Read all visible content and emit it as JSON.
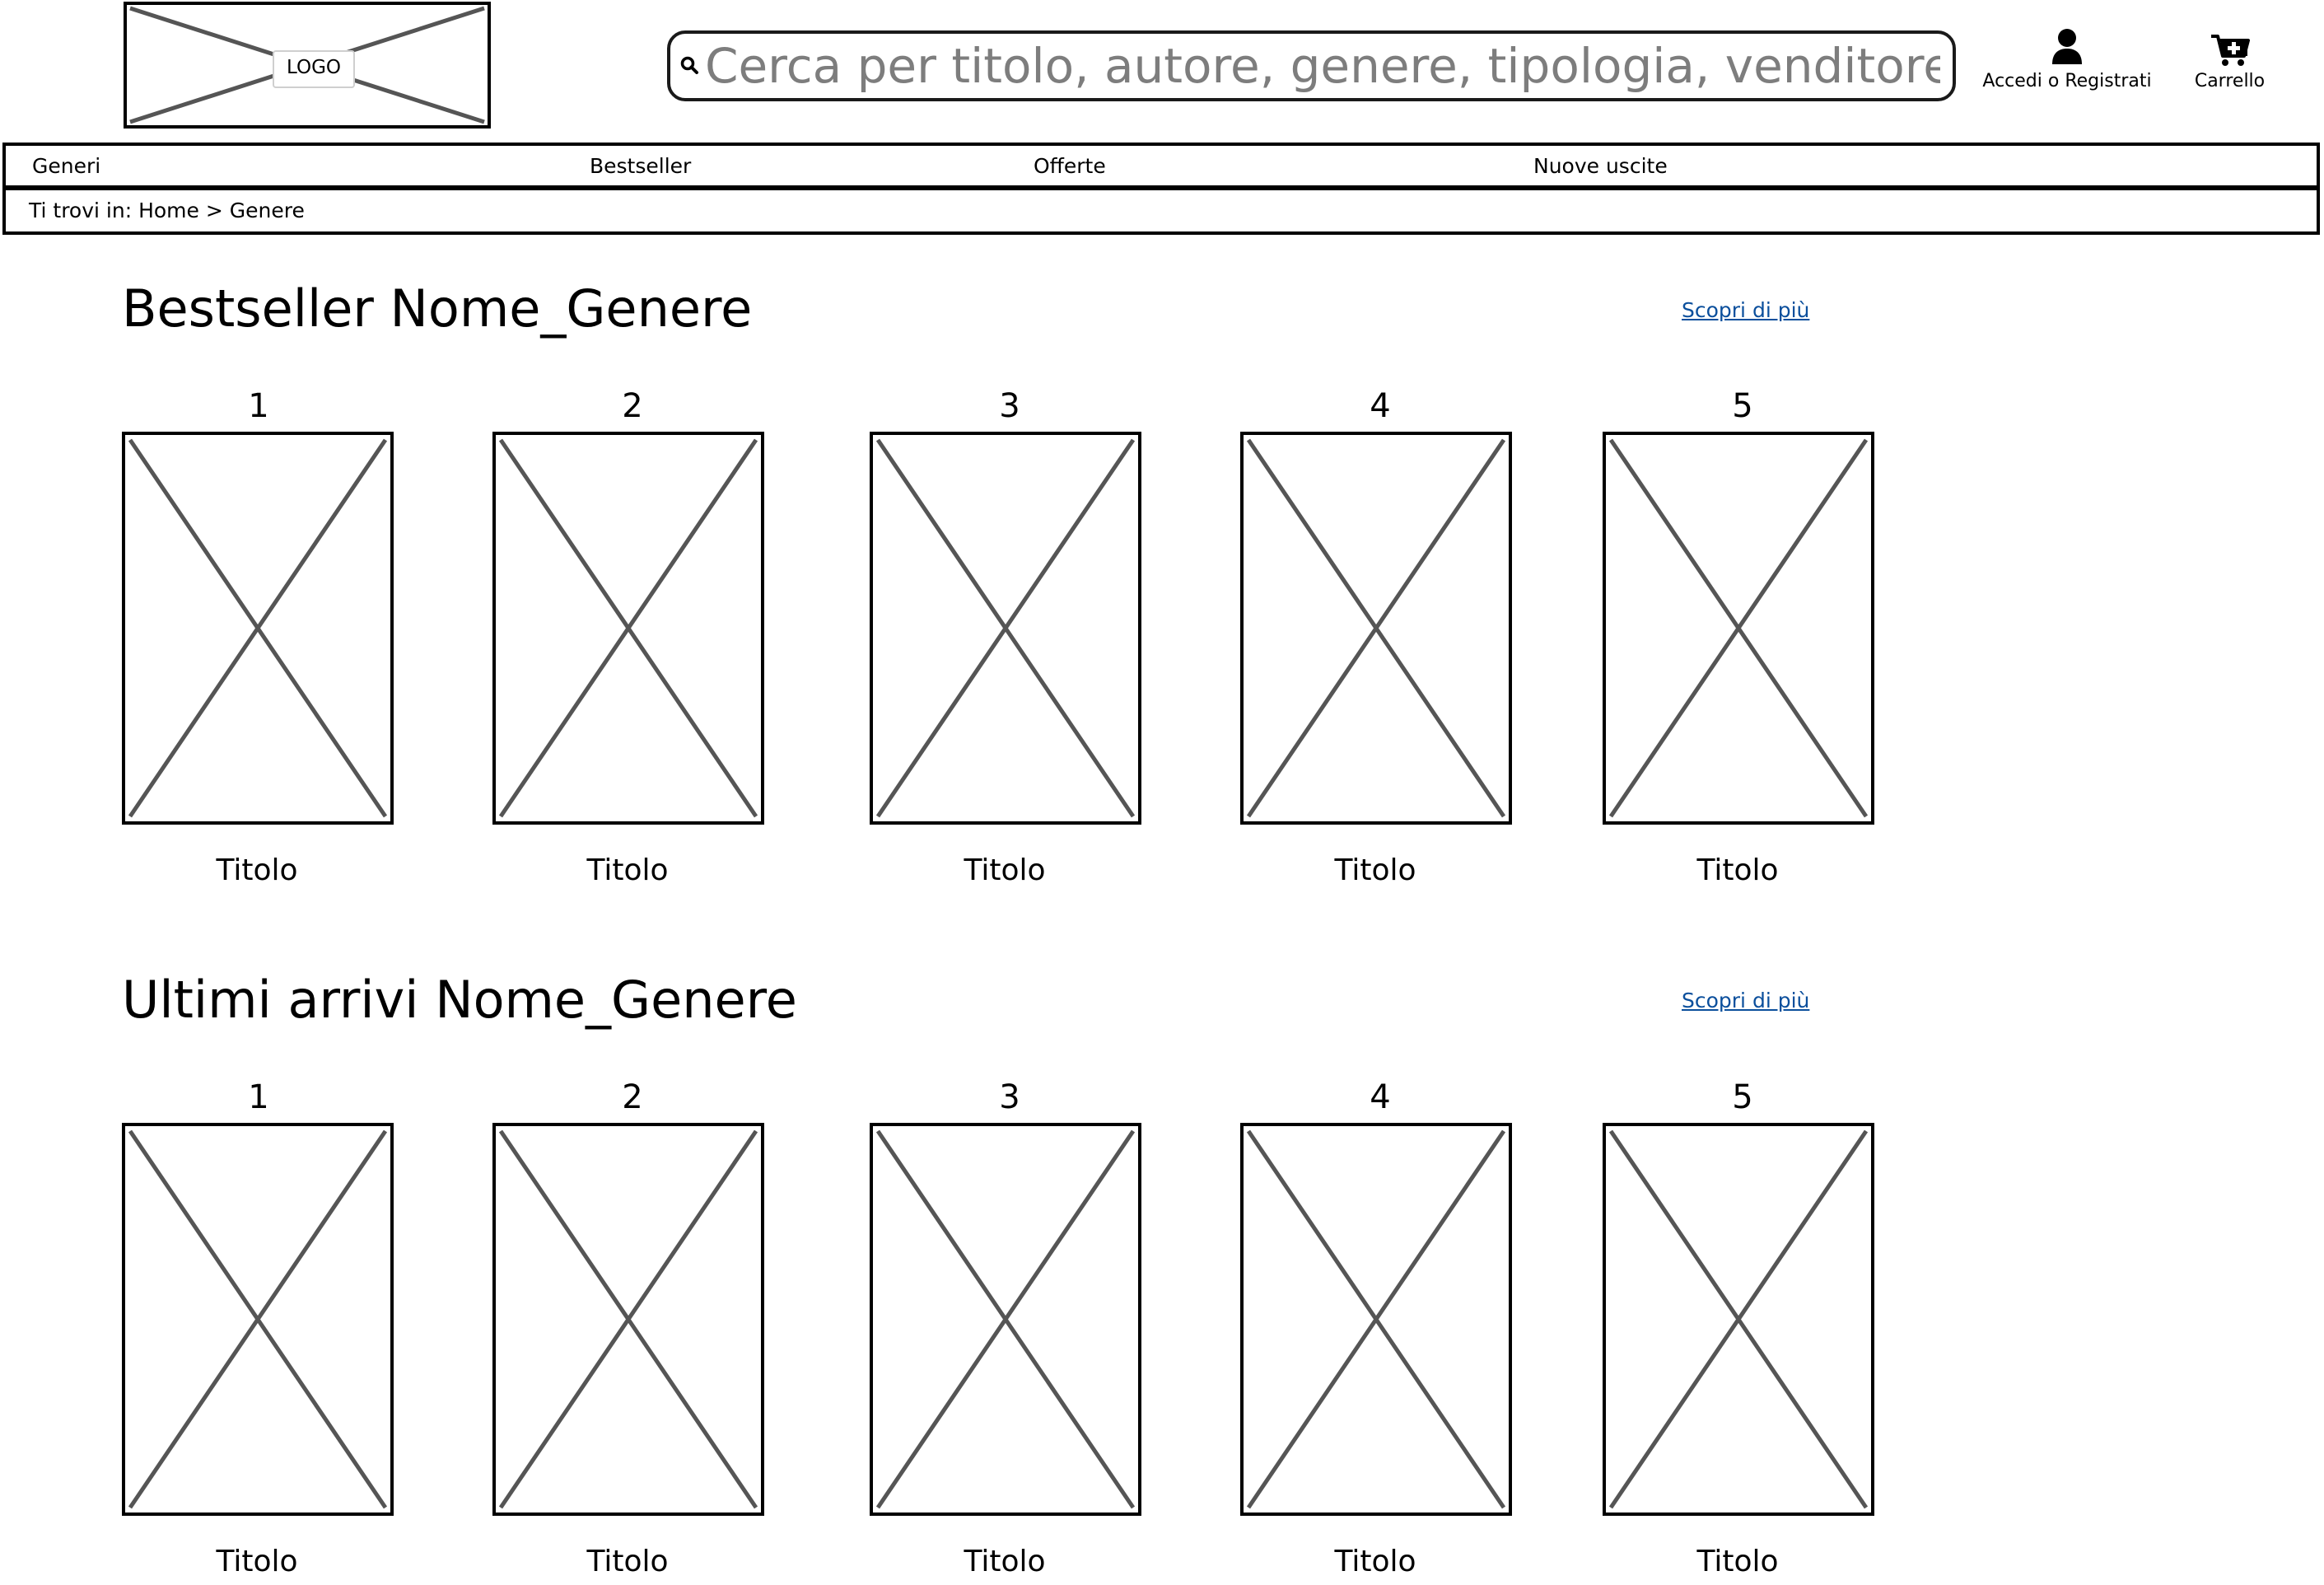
{
  "header": {
    "logo_text": "LOGO",
    "search": {
      "placeholder": "Cerca per titolo, autore, genere, tipologia, venditore...",
      "value": ""
    },
    "account_label": "Accedi o Registrati",
    "cart_label": "Carrello",
    "icons": {
      "search": "search-icon",
      "account": "user-icon",
      "cart": "cart-plus-icon"
    }
  },
  "nav": {
    "items": [
      {
        "label": "Generi"
      },
      {
        "label": "Bestseller"
      },
      {
        "label": "Offerte"
      },
      {
        "label": "Nuove uscite"
      }
    ]
  },
  "breadcrumb": {
    "text": "Ti trovi in: Home > Genere"
  },
  "sections": [
    {
      "title": "Bestseller Nome_Genere",
      "more_label": "Scopri di più",
      "books": [
        {
          "rank": "1",
          "title": "Titolo"
        },
        {
          "rank": "2",
          "title": "Titolo"
        },
        {
          "rank": "3",
          "title": "Titolo"
        },
        {
          "rank": "4",
          "title": "Titolo"
        },
        {
          "rank": "5",
          "title": "Titolo"
        }
      ]
    },
    {
      "title": "Ultimi arrivi Nome_Genere",
      "more_label": "Scopri di più",
      "books": [
        {
          "rank": "1",
          "title": "Titolo"
        },
        {
          "rank": "2",
          "title": "Titolo"
        },
        {
          "rank": "3",
          "title": "Titolo"
        },
        {
          "rank": "4",
          "title": "Titolo"
        },
        {
          "rank": "5",
          "title": "Titolo"
        }
      ]
    }
  ],
  "colors": {
    "link": "#0b4f9c",
    "placeholder_cross": "#555555",
    "border": "#000000"
  }
}
